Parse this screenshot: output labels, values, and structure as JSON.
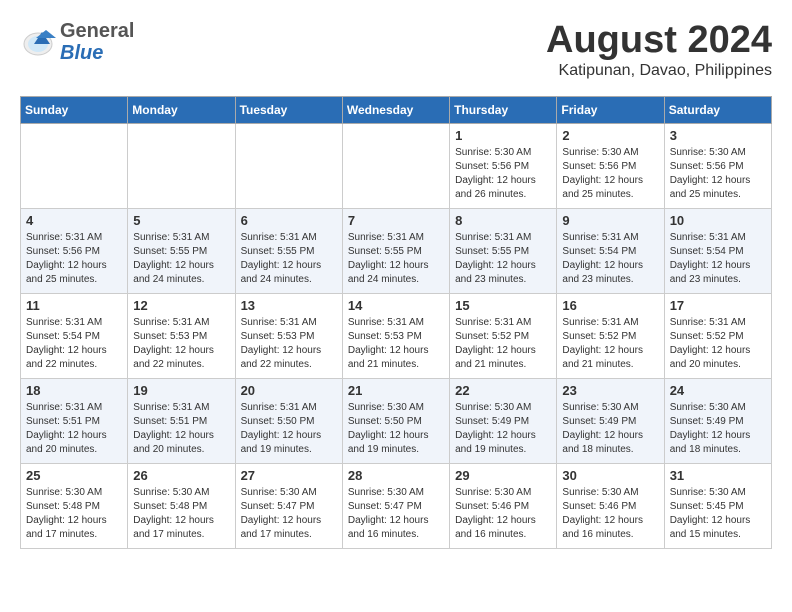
{
  "header": {
    "logo_general": "General",
    "logo_blue": "Blue",
    "month_title": "August 2024",
    "location": "Katipunan, Davao, Philippines"
  },
  "weekdays": [
    "Sunday",
    "Monday",
    "Tuesday",
    "Wednesday",
    "Thursday",
    "Friday",
    "Saturday"
  ],
  "weeks": [
    [
      {
        "day": "",
        "info": ""
      },
      {
        "day": "",
        "info": ""
      },
      {
        "day": "",
        "info": ""
      },
      {
        "day": "",
        "info": ""
      },
      {
        "day": "1",
        "info": "Sunrise: 5:30 AM\nSunset: 5:56 PM\nDaylight: 12 hours\nand 26 minutes."
      },
      {
        "day": "2",
        "info": "Sunrise: 5:30 AM\nSunset: 5:56 PM\nDaylight: 12 hours\nand 25 minutes."
      },
      {
        "day": "3",
        "info": "Sunrise: 5:30 AM\nSunset: 5:56 PM\nDaylight: 12 hours\nand 25 minutes."
      }
    ],
    [
      {
        "day": "4",
        "info": "Sunrise: 5:31 AM\nSunset: 5:56 PM\nDaylight: 12 hours\nand 25 minutes."
      },
      {
        "day": "5",
        "info": "Sunrise: 5:31 AM\nSunset: 5:55 PM\nDaylight: 12 hours\nand 24 minutes."
      },
      {
        "day": "6",
        "info": "Sunrise: 5:31 AM\nSunset: 5:55 PM\nDaylight: 12 hours\nand 24 minutes."
      },
      {
        "day": "7",
        "info": "Sunrise: 5:31 AM\nSunset: 5:55 PM\nDaylight: 12 hours\nand 24 minutes."
      },
      {
        "day": "8",
        "info": "Sunrise: 5:31 AM\nSunset: 5:55 PM\nDaylight: 12 hours\nand 23 minutes."
      },
      {
        "day": "9",
        "info": "Sunrise: 5:31 AM\nSunset: 5:54 PM\nDaylight: 12 hours\nand 23 minutes."
      },
      {
        "day": "10",
        "info": "Sunrise: 5:31 AM\nSunset: 5:54 PM\nDaylight: 12 hours\nand 23 minutes."
      }
    ],
    [
      {
        "day": "11",
        "info": "Sunrise: 5:31 AM\nSunset: 5:54 PM\nDaylight: 12 hours\nand 22 minutes."
      },
      {
        "day": "12",
        "info": "Sunrise: 5:31 AM\nSunset: 5:53 PM\nDaylight: 12 hours\nand 22 minutes."
      },
      {
        "day": "13",
        "info": "Sunrise: 5:31 AM\nSunset: 5:53 PM\nDaylight: 12 hours\nand 22 minutes."
      },
      {
        "day": "14",
        "info": "Sunrise: 5:31 AM\nSunset: 5:53 PM\nDaylight: 12 hours\nand 21 minutes."
      },
      {
        "day": "15",
        "info": "Sunrise: 5:31 AM\nSunset: 5:52 PM\nDaylight: 12 hours\nand 21 minutes."
      },
      {
        "day": "16",
        "info": "Sunrise: 5:31 AM\nSunset: 5:52 PM\nDaylight: 12 hours\nand 21 minutes."
      },
      {
        "day": "17",
        "info": "Sunrise: 5:31 AM\nSunset: 5:52 PM\nDaylight: 12 hours\nand 20 minutes."
      }
    ],
    [
      {
        "day": "18",
        "info": "Sunrise: 5:31 AM\nSunset: 5:51 PM\nDaylight: 12 hours\nand 20 minutes."
      },
      {
        "day": "19",
        "info": "Sunrise: 5:31 AM\nSunset: 5:51 PM\nDaylight: 12 hours\nand 20 minutes."
      },
      {
        "day": "20",
        "info": "Sunrise: 5:31 AM\nSunset: 5:50 PM\nDaylight: 12 hours\nand 19 minutes."
      },
      {
        "day": "21",
        "info": "Sunrise: 5:30 AM\nSunset: 5:50 PM\nDaylight: 12 hours\nand 19 minutes."
      },
      {
        "day": "22",
        "info": "Sunrise: 5:30 AM\nSunset: 5:49 PM\nDaylight: 12 hours\nand 19 minutes."
      },
      {
        "day": "23",
        "info": "Sunrise: 5:30 AM\nSunset: 5:49 PM\nDaylight: 12 hours\nand 18 minutes."
      },
      {
        "day": "24",
        "info": "Sunrise: 5:30 AM\nSunset: 5:49 PM\nDaylight: 12 hours\nand 18 minutes."
      }
    ],
    [
      {
        "day": "25",
        "info": "Sunrise: 5:30 AM\nSunset: 5:48 PM\nDaylight: 12 hours\nand 17 minutes."
      },
      {
        "day": "26",
        "info": "Sunrise: 5:30 AM\nSunset: 5:48 PM\nDaylight: 12 hours\nand 17 minutes."
      },
      {
        "day": "27",
        "info": "Sunrise: 5:30 AM\nSunset: 5:47 PM\nDaylight: 12 hours\nand 17 minutes."
      },
      {
        "day": "28",
        "info": "Sunrise: 5:30 AM\nSunset: 5:47 PM\nDaylight: 12 hours\nand 16 minutes."
      },
      {
        "day": "29",
        "info": "Sunrise: 5:30 AM\nSunset: 5:46 PM\nDaylight: 12 hours\nand 16 minutes."
      },
      {
        "day": "30",
        "info": "Sunrise: 5:30 AM\nSunset: 5:46 PM\nDaylight: 12 hours\nand 16 minutes."
      },
      {
        "day": "31",
        "info": "Sunrise: 5:30 AM\nSunset: 5:45 PM\nDaylight: 12 hours\nand 15 minutes."
      }
    ]
  ]
}
